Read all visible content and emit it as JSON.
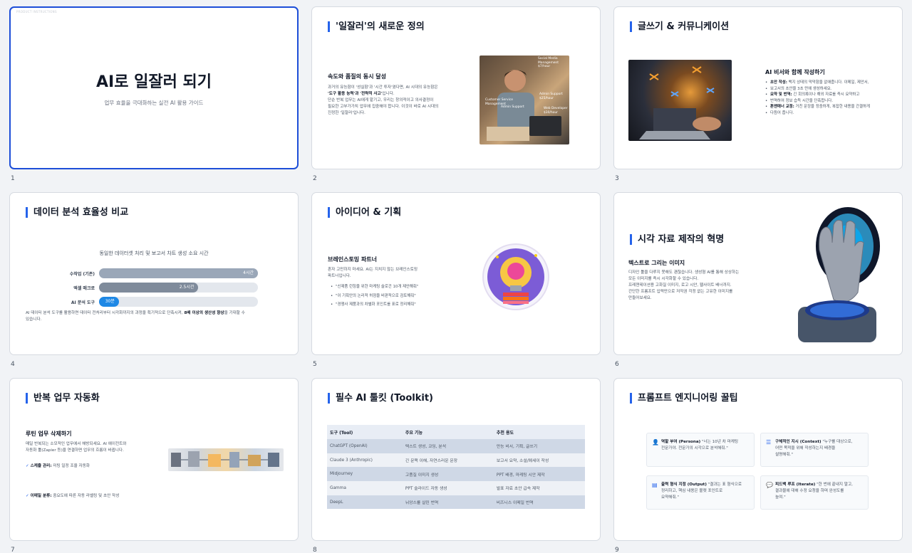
{
  "slides": [
    {
      "number": "1",
      "brand": "PRODUCT INSTRUCTIONS",
      "title": "AI로 일잘러 되기",
      "subtitle": "업무 효율을 극대화하는 실전 AI 활용 가이드"
    },
    {
      "number": "2",
      "title": "'일잘러'의 새로운 정의",
      "heading": "속도와 품질의 동시 달성",
      "body_1": "과거의 유능함이 '성실함'과 '시간 투자'였다면, AI 시대의 유능함은",
      "body_2_bold": "'도구 활용 능력'과 '전략적 사고'",
      "body_2_rest": "입니다.",
      "body_3": "단순 반복 업무는 AI에게 맡기고, 우리는 창의적이고 의사결정이",
      "body_4": "필요한 고부가가치 업무에 집중해야 합니다. 이것이 바로 AI 시대의",
      "body_5": "진정한 '일잘러'입니다.",
      "image_text": {
        "a": "Social Media Management",
        "a_price": "$7/hour",
        "b": "Customer Service Management",
        "c": "Admin Support",
        "c_price": "$25/hour",
        "d": "Web Developer",
        "d_price": "$30/hour"
      }
    },
    {
      "number": "3",
      "title": "글쓰기 & 커뮤니케이션",
      "heading": "AI 비서와 함께 작성하기",
      "bullets": [
        {
          "bold": "초안 작성:",
          "text": " 백지 상태의 막막함을 없애줍니다. 이메일, 제안서,"
        },
        {
          "bold": "",
          "text": "보고서의 초안을 3초 만에 생성하세요."
        },
        {
          "bold": "요약 및 번역:",
          "text": " 긴 회의록이나 해외 자료를 즉시 요약하고"
        },
        {
          "bold": "",
          "text": "번역하여 정보 습득 시간을 단축합니다."
        },
        {
          "bold": "톤앤매너 교정:",
          "text": " 거친 문장을 정중하게, 복잡한 내용을 간결하게"
        },
        {
          "bold": "",
          "text": "다듬어 줍니다."
        }
      ]
    },
    {
      "number": "4",
      "title": "데이터 분석 효율성 비교",
      "footer_1": "AI 데이터 분석 도구를 활용하면 데이터 전처리부터 시각화까지의 과정을 획기적으로 단축시켜,",
      "footer_bold": " 8배 이상의 생산성 향상",
      "footer_2": "을 기대할 수",
      "footer_3": "있습니다."
    },
    {
      "number": "5",
      "title": "아이디어 & 기획",
      "heading": "브레인스토밍 파트너",
      "body_1": "혼자 고민하지 마세요. AI는 지치지 않는 브레인스토밍",
      "body_2": "파트너입니다.",
      "bullets": [
        "\"신제품 런칭을 위한 마케팅 슬로건 10개 제안해줘\"",
        "\"이 기획안의 논리적 허점을 비판적으로 검토해줘\"",
        "\"경쟁사 제품과의 차별화 포인트를 표로 정리해줘\""
      ]
    },
    {
      "number": "6",
      "title": "시각 자료 제작의 혁명",
      "heading": "텍스트로 그리는 이미지",
      "body_1": "디자인 툴을 다루지 못해도 괜찮습니다. 생성형 AI를 통해 상상하는",
      "body_2": "모든 이미지를 즉시 시각화할 수 있습니다.",
      "body_3": "프레젠테이션용 고화질 이미지, 로고 시안, 웹사이트 배너까지.",
      "body_4": "간단한 프롬프트 입력만으로 저작권 걱정 없는 고유한 이미지를",
      "body_5": "만들어보세요."
    },
    {
      "number": "7",
      "title": "반복 업무 자동화",
      "heading": "루틴 업무 삭제하기",
      "body_1": "매일 반복되는 소모적인 업무에서 해방되세요. AI 에이전트와",
      "body_2": "자동화 툴(Zapier 등)을 연결하면 업무의 흐름이 바뀝니다.",
      "check_1_bold": "스케줄 관리:",
      "check_1": " 미팅 일정 조율 자동화",
      "check_2_bold": "이메일 분류:",
      "check_2": " 중요도에 따른 자동 라벨링 및 초안 작성"
    },
    {
      "number": "8",
      "title": "필수 AI 툴킷 (Toolkit)",
      "table": {
        "headers": [
          "도구 (Tool)",
          "주요 기능",
          "추천 용도"
        ],
        "rows": [
          [
            "ChatGPT (OpenAI)",
            "텍스트 생성, 코딩, 분석",
            "만능 비서, 기획, 글쓰기"
          ],
          [
            "Claude 3 (Anthropic)",
            "긴 문맥 이해, 자연스러운 문장",
            "보고서 요약, 소설/에세이 작성"
          ],
          [
            "Midjourney",
            "고품질 이미지 생성",
            "PPT 배경, 마케팅 시안 제작"
          ],
          [
            "Gamma",
            "PPT 슬라이드 자동 생성",
            "발표 자료 초안 급속 제작"
          ],
          [
            "DeepL",
            "뉘앙스를 살린 번역",
            "비즈니스 이메일 번역"
          ]
        ]
      }
    },
    {
      "number": "9",
      "title": "프롬프트 엔지니어링 꿀팁",
      "cards": [
        {
          "bold": "역할 부여 (Persona)",
          "text_1": " \"너는 10년 차 마케팅",
          "text_2": "전문가야. 전문가의 시각으로 분석해줘.\""
        },
        {
          "bold": "구체적인 지시 (Context)",
          "text_1": " \"누구를 대상으로,",
          "text_2": "어떤 목적을 위해 작성하는지 배경을",
          "text_3": "설명해줘.\""
        },
        {
          "bold": "출력 형식 지정 (Output)",
          "text_1": " \"결과는 표 형식으로",
          "text_2": "정리하고, 핵심 내용은 볼렛 포인트로",
          "text_3": "요약해줘.\""
        },
        {
          "bold": "피드백 루프 (Iterate)",
          "text_1": " \"한 번에 끝내지 말고,",
          "text_2": "결과물에 대해 수정 요청을 하며 완성도를",
          "text_3": "높여.\""
        }
      ]
    }
  ],
  "chart_data": {
    "type": "bar",
    "title": "동일한 데이터셋 처리 및 보고서 차트 생성 소요 시간",
    "categories": [
      "수작업 (기존)",
      "엑셀 매크로",
      "AI 분석 도구"
    ],
    "values": [
      240,
      150,
      30
    ],
    "value_labels": [
      "4시간",
      "2.5시간",
      "30분"
    ],
    "unit": "minutes",
    "xlim": [
      0,
      240
    ],
    "orientation": "horizontal",
    "colors": [
      "#9aa7b8",
      "#7f8b9b",
      "#1e88e5"
    ],
    "grid": false
  },
  "colors": {
    "accent": "#2563eb",
    "selected_border": "#1d4ed8"
  }
}
